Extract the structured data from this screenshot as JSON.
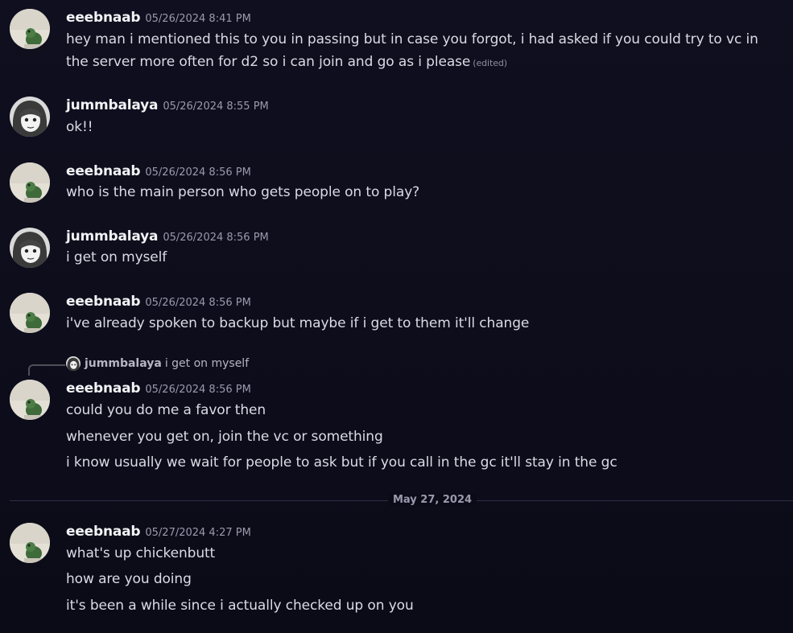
{
  "messages": [
    {
      "username": "eeebnaab",
      "timestamp": "05/26/2024 8:41 PM",
      "text": "hey man i mentioned this to you in passing but in case you forgot, i had asked if you could try to vc in the server more often for d2 so i can join and go as i please",
      "edited": "(edited)"
    },
    {
      "username": "jummbalaya",
      "timestamp": "05/26/2024 8:55 PM",
      "text": "ok!!"
    },
    {
      "username": "eeebnaab",
      "timestamp": "05/26/2024 8:56 PM",
      "text": "who is the main person who gets people on to play?"
    },
    {
      "username": "jummbalaya",
      "timestamp": "05/26/2024 8:56 PM",
      "text": "i get on myself"
    },
    {
      "username": "eeebnaab",
      "timestamp": "05/26/2024 8:56 PM",
      "text": "i've already spoken to backup but maybe if i get to them it'll change"
    },
    {
      "reply": {
        "username": "jummbalaya",
        "text": "i get on myself"
      },
      "username": "eeebnaab",
      "timestamp": "05/26/2024 8:56 PM",
      "lines": [
        "could you do me a favor then",
        "whenever you get on, join the vc or something",
        "i know usually we wait for people to ask but if you call in the gc it'll stay in the gc"
      ]
    },
    {
      "username": "eeebnaab",
      "timestamp": "05/27/2024 4:27 PM",
      "lines": [
        "what's up chickenbutt",
        "how are you doing",
        "it's been a while since i actually checked up on you"
      ]
    }
  ],
  "divider": {
    "label": "May 27, 2024"
  },
  "avatars": {
    "eeebnaab": "frog-figurine-avatar",
    "jummbalaya": "manga-girl-avatar"
  },
  "colors": {
    "background": "#0f0f1f",
    "username": "#f2f3f5",
    "text": "#dbdbe6",
    "timestamp": "#9a9aae"
  }
}
